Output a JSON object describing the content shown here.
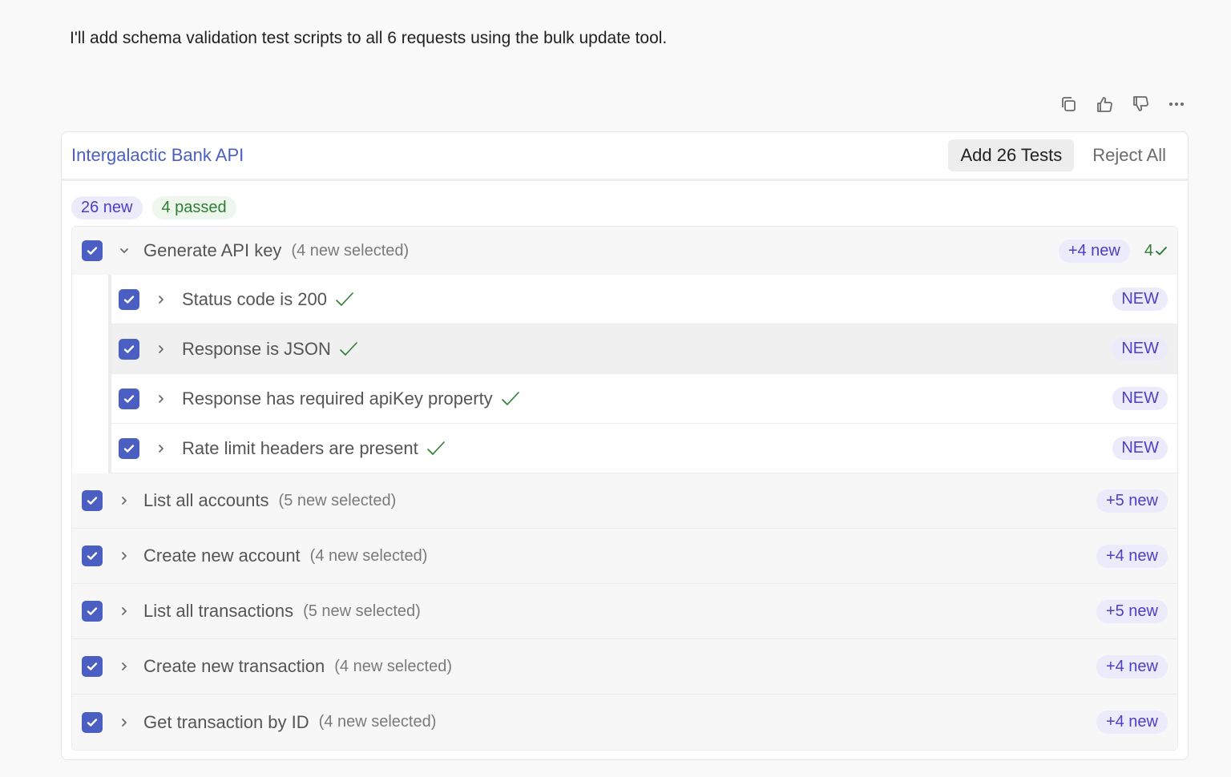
{
  "message": "I'll add schema validation test scripts to all 6 requests using the bulk update tool.",
  "message_actions": {
    "copy": "copy-icon",
    "like": "thumbs-up-icon",
    "dislike": "thumbs-down-icon",
    "more": "more-icon"
  },
  "panel": {
    "collection_name": "Intergalactic Bank API",
    "add_button": "Add 26 Tests",
    "reject_button": "Reject All",
    "summary": {
      "new": "26 new",
      "passed": "4 passed"
    },
    "expanded_group": {
      "title": "Generate API key",
      "subtitle": "(4 new selected)",
      "new_badge": "+4 new",
      "passed_badge": "4",
      "tests": [
        {
          "title": "Status code is 200",
          "tag": "NEW"
        },
        {
          "title": "Response is JSON",
          "tag": "NEW"
        },
        {
          "title": "Response has required apiKey property",
          "tag": "NEW"
        },
        {
          "title": "Rate limit headers are present",
          "tag": "NEW"
        }
      ]
    },
    "groups": [
      {
        "title": "List all accounts",
        "subtitle": "(5 new selected)",
        "badge": "+5 new"
      },
      {
        "title": "Create new account",
        "subtitle": "(4 new selected)",
        "badge": "+4 new"
      },
      {
        "title": "List all transactions",
        "subtitle": "(5 new selected)",
        "badge": "+5 new"
      },
      {
        "title": "Create new transaction",
        "subtitle": "(4 new selected)",
        "badge": "+4 new"
      },
      {
        "title": "Get transaction by ID",
        "subtitle": "(4 new selected)",
        "badge": "+4 new"
      }
    ]
  },
  "colors": {
    "accent": "#4a5fc1",
    "new_badge_bg": "#ecebfb",
    "new_badge_text": "#4b3fc7",
    "pass_text": "#2e7d32"
  }
}
